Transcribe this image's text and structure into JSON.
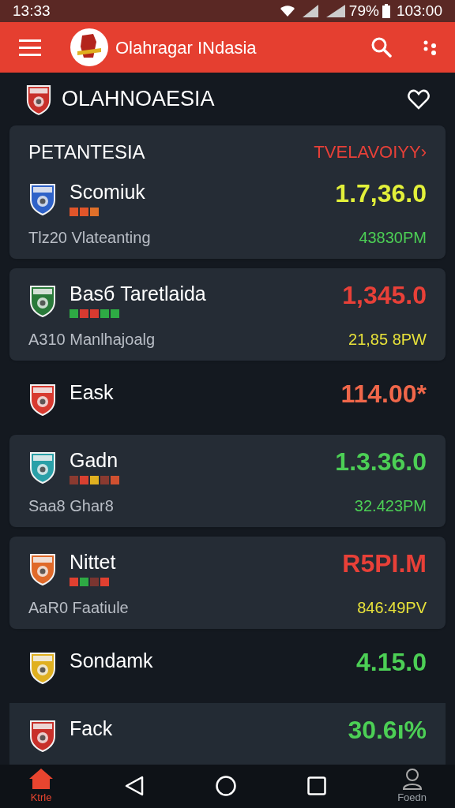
{
  "status_bar": {
    "time": "13:33",
    "battery": "79%",
    "clock": "103:00"
  },
  "app_bar": {
    "title": "Olahragar INdasia"
  },
  "header": {
    "title": "OLAHNOAESIA"
  },
  "section": {
    "title": "PETANTESIA",
    "link": "TVELAVOIYY›"
  },
  "entries": [
    {
      "kind": "card",
      "name": "Scomiuk",
      "crest": {
        "color": "#2f62c8"
      },
      "markers": [
        {
          "color": "#e0552a"
        },
        {
          "color": "#e0552a"
        },
        {
          "color": "#e0702a"
        }
      ],
      "subtitle": "Tlz20  Vlateanting",
      "value": {
        "text": "1.7,36.0",
        "color": "#e2f03a"
      },
      "time": {
        "text": "43830PM",
        "color": "#4ccf55"
      }
    },
    {
      "kind": "card",
      "name": "Basб Taretlaida",
      "crest": {
        "color": "#2a7a3a"
      },
      "markers": [
        {
          "color": "#2eaa44"
        },
        {
          "color": "#d83a30"
        },
        {
          "color": "#d83a30"
        },
        {
          "color": "#2eaa44"
        },
        {
          "color": "#2eaa44"
        }
      ],
      "subtitle": "A310  Manlhajoalg",
      "value": {
        "text": "1,345.0",
        "color": "#e84038"
      },
      "time": {
        "text": "21,85 8PW",
        "color": "#e8e23a"
      }
    },
    {
      "kind": "plain",
      "name": "Eask",
      "crest": {
        "color": "#d83a30"
      },
      "value": {
        "text": "114.00*",
        "color": "#f0674a"
      }
    },
    {
      "kind": "card",
      "name": "Gadn",
      "crest": {
        "color": "#2aa0a8"
      },
      "markers": [
        {
          "color": "#8a3a30"
        },
        {
          "color": "#d84030"
        },
        {
          "color": "#e0b020"
        },
        {
          "color": "#8a3a30"
        },
        {
          "color": "#d05030"
        }
      ],
      "subtitle": "Saa8  Ghar8",
      "value": {
        "text": "1.3.36.0",
        "color": "#4ccf55"
      },
      "time": {
        "text": "32.423PM",
        "color": "#4ccf55"
      }
    },
    {
      "kind": "card",
      "name": "Nittet",
      "crest": {
        "color": "#e06a2a"
      },
      "markers": [
        {
          "color": "#e04030"
        },
        {
          "color": "#2eaa44"
        },
        {
          "color": "#7a3530"
        },
        {
          "color": "#e04030"
        }
      ],
      "subtitle": "AaR0  Faatiule",
      "value": {
        "text": "R5PI.M",
        "color": "#e84038"
      },
      "time": {
        "text": "846:49PV",
        "color": "#e8e23a"
      }
    },
    {
      "kind": "plain",
      "name": "Sondamk",
      "crest": {
        "color": "#e0b020"
      },
      "value": {
        "text": "4.15.0",
        "color": "#4ccf55"
      }
    },
    {
      "kind": "band",
      "name": "Fack",
      "crest": {
        "color": "#c8302a"
      },
      "value": {
        "text": "30.6ı%",
        "color": "#4ccf55"
      }
    }
  ],
  "nav": [
    {
      "kind": "home",
      "label": "Ktrle",
      "selected": true
    },
    {
      "kind": "back"
    },
    {
      "kind": "circle"
    },
    {
      "kind": "square"
    },
    {
      "kind": "person",
      "label": "Foedn",
      "selected": false
    }
  ]
}
